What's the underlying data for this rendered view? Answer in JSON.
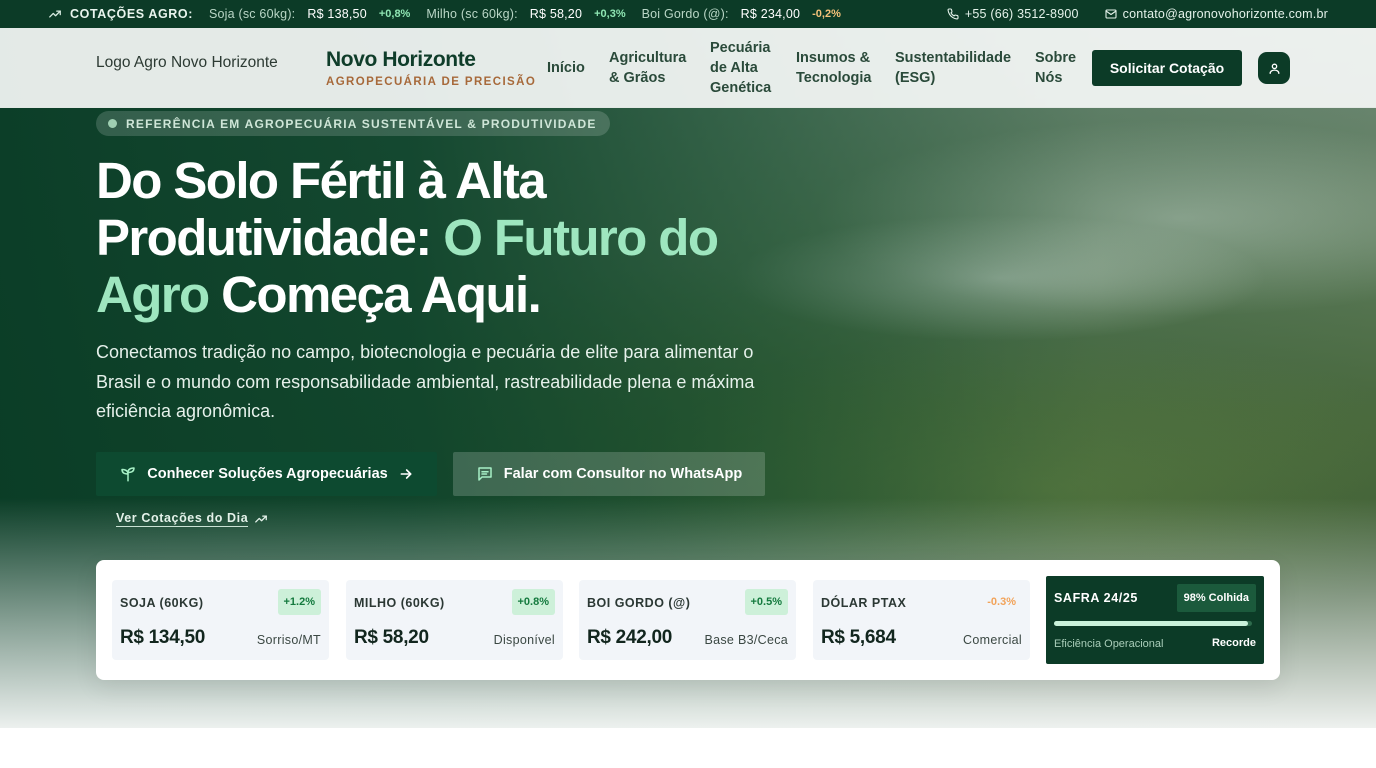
{
  "ticker": {
    "title": "COTAÇÕES AGRO:",
    "items": [
      {
        "name": "Soja (sc 60kg):",
        "value": "R$ 138,50",
        "change": "+0,8%",
        "direction": "up"
      },
      {
        "name": "Milho (sc 60kg):",
        "value": "R$ 58,20",
        "change": "+0,3%",
        "direction": "up"
      },
      {
        "name": "Boi Gordo (@):",
        "value": "R$ 234,00",
        "change": "-0,2%",
        "direction": "down"
      }
    ],
    "phone": "+55 (66) 3512-8900",
    "email": "contato@agronovohorizonte.com.br"
  },
  "header": {
    "logo_alt": "Logo Agro Novo Horizonte",
    "brand_name": "Novo Horizonte",
    "brand_sub": "AGROPECUÁRIA DE PRECISÃO",
    "nav": [
      {
        "label": "Início"
      },
      {
        "label": "Agricultura & Grãos"
      },
      {
        "label": "Pecuária de Alta Genética"
      },
      {
        "label": "Insumos & Tecnologia"
      },
      {
        "label": "Sustentabilidade (ESG)"
      },
      {
        "label": "Sobre Nós"
      }
    ],
    "cta": "Solicitar Cotação"
  },
  "hero": {
    "badge": "REFERÊNCIA EM AGROPECUÁRIA SUSTENTÁVEL & PRODUTIVIDADE",
    "headline_part1": "Do Solo Fértil à Alta Produtividade:",
    "headline_accent": "O Futuro do Agro",
    "headline_part2": "Começa Aqui.",
    "lead": "Conectamos tradição no campo, biotecnologia e pecuária de elite para alimentar o Brasil e o mundo com responsabilidade ambiental, rastreabilidade plena e máxima eficiência agronômica.",
    "primary_button": "Conhecer Soluções Agropecuárias",
    "secondary_button": "Falar com Consultor no WhatsApp",
    "link": "Ver Cotações do Dia"
  },
  "quotes": [
    {
      "name": "SOJA (60KG)",
      "change": "+1.2%",
      "direction": "up",
      "value": "R$ 134,50",
      "note": "Sorriso/MT"
    },
    {
      "name": "MILHO (60KG)",
      "change": "+0.8%",
      "direction": "up",
      "value": "R$ 58,20",
      "note": "Disponível"
    },
    {
      "name": "BOI GORDO (@)",
      "change": "+0.5%",
      "direction": "up",
      "value": "R$ 242,00",
      "note": "Base B3/Ceca"
    },
    {
      "name": "DÓLAR PTAX",
      "change": "-0.3%",
      "direction": "down",
      "value": "R$ 5,684",
      "note": "Comercial"
    }
  ],
  "safra": {
    "title": "SAFRA 24/25",
    "badge": "98% Colhida",
    "progress": 0.98,
    "label": "Eficiência Operacional",
    "note": "Recorde"
  },
  "colors": {
    "brand_dark": "#0c3b27",
    "accent_green": "#9ee6bf",
    "brand_copper": "#a7693a",
    "up": "#147a3e",
    "down": "#f2a35a"
  }
}
